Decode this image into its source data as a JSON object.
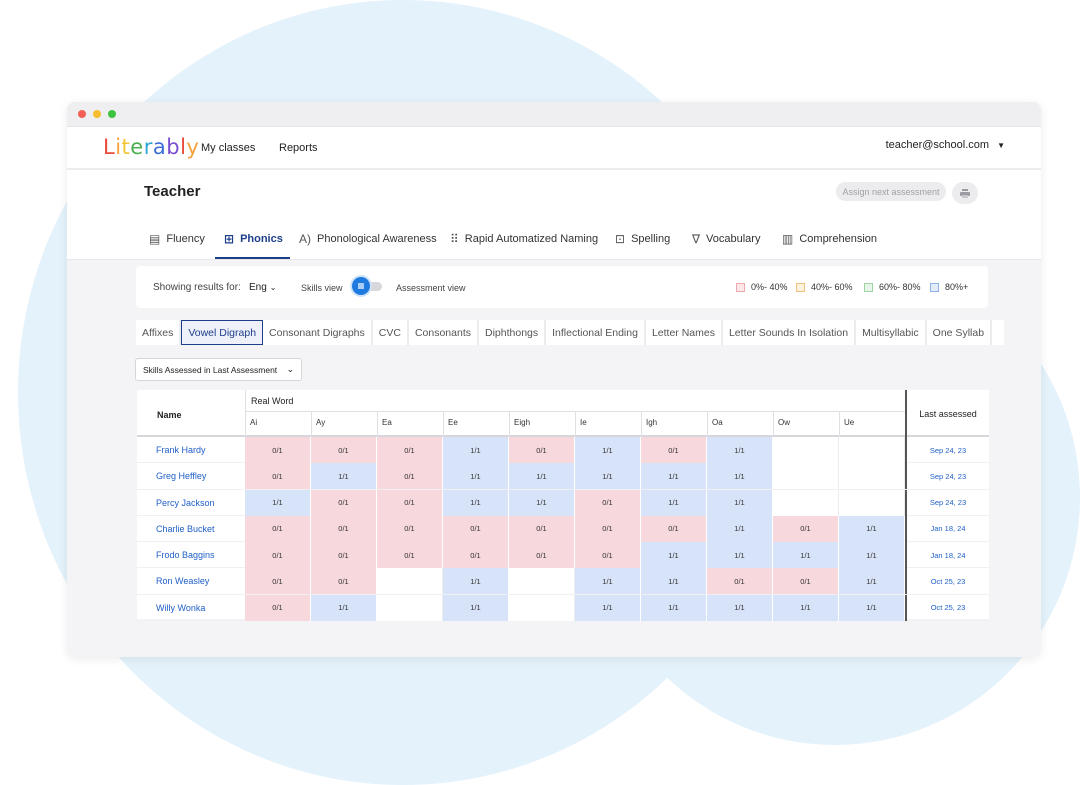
{
  "app": {
    "logo_letters": [
      {
        "ch": "L",
        "color": "#e84c3d"
      },
      {
        "ch": "i",
        "color": "#f3a33a"
      },
      {
        "ch": "t",
        "color": "#f3c531"
      },
      {
        "ch": "e",
        "color": "#4caf50"
      },
      {
        "ch": "r",
        "color": "#2fa7d9"
      },
      {
        "ch": "a",
        "color": "#3b6fd6"
      },
      {
        "ch": "b",
        "color": "#7b4fd1"
      },
      {
        "ch": "l",
        "color": "#e84c3d"
      },
      {
        "ch": "y",
        "color": "#f3a33a"
      }
    ],
    "nav": {
      "my_classes": "My classes",
      "reports": "Reports"
    },
    "user_email": "teacher@school.com"
  },
  "header": {
    "title": "Teacher",
    "assign_label": "Assign next assessment"
  },
  "tabs": [
    {
      "label": "Fluency",
      "icon": "fluency-icon",
      "active": false
    },
    {
      "label": "Phonics",
      "icon": "phonics-icon",
      "active": true
    },
    {
      "label": "Phonological Awareness",
      "icon": "phonological-icon",
      "active": false
    },
    {
      "label": "Rapid Automatized Naming",
      "icon": "ran-grid-icon",
      "active": false
    },
    {
      "label": "Spelling",
      "icon": "spelling-icon",
      "active": false
    },
    {
      "label": "Vocabulary",
      "icon": "vocabulary-icon",
      "active": false
    },
    {
      "label": "Comprehension",
      "icon": "book-icon",
      "active": false
    }
  ],
  "filters": {
    "showing_label": "Showing results for:",
    "language": "Eng",
    "skills_view": "Skills view",
    "assessment_view": "Assessment view",
    "legend": [
      {
        "label": "0%- 40%",
        "color": "#f0a7ae",
        "fill": "#fbe6e8"
      },
      {
        "label": "40%- 60%",
        "color": "#f3c07a",
        "fill": "#fdf1df"
      },
      {
        "label": "60%- 80%",
        "color": "#9fd3a3",
        "fill": "#e7f5e8"
      },
      {
        "label": "80%+",
        "color": "#8fb1ea",
        "fill": "#e3ecfb"
      }
    ]
  },
  "skill_tabs": [
    "Affixes",
    "Vowel Digraph",
    "Consonant Digraphs",
    "CVC",
    "Consonants",
    "Diphthongs",
    "Inflectional Ending",
    "Letter Names",
    "Letter Sounds In Isolation",
    "Multisyllabic",
    "One Syllab"
  ],
  "active_skill_tab": "Vowel Digraph",
  "dropdown": {
    "label": "Skills Assessed in Last Assessment"
  },
  "grid": {
    "name_header": "Name",
    "group_header": "Real Word",
    "last_header": "Last assessed",
    "columns": [
      "Ai",
      "Ay",
      "Ea",
      "Ee",
      "Eigh",
      "Ie",
      "Igh",
      "Oa",
      "Ow",
      "Ue"
    ],
    "rows": [
      {
        "name": "Frank Hardy",
        "date": "Sep 24, 23",
        "cells": [
          "0/1",
          "0/1",
          "0/1",
          "1/1",
          "0/1",
          "1/1",
          "0/1",
          "1/1",
          "",
          ""
        ]
      },
      {
        "name": "Greg Heffley",
        "date": "Sep 24, 23",
        "cells": [
          "0/1",
          "1/1",
          "0/1",
          "1/1",
          "1/1",
          "1/1",
          "1/1",
          "1/1",
          "",
          ""
        ]
      },
      {
        "name": "Percy Jackson",
        "date": "Sep 24, 23",
        "cells": [
          "1/1",
          "0/1",
          "0/1",
          "1/1",
          "1/1",
          "0/1",
          "1/1",
          "1/1",
          "",
          ""
        ]
      },
      {
        "name": "Charlie Bucket",
        "date": "Jan 18, 24",
        "cells": [
          "0/1",
          "0/1",
          "0/1",
          "0/1",
          "0/1",
          "0/1",
          "0/1",
          "1/1",
          "0/1",
          "1/1"
        ]
      },
      {
        "name": "Frodo Baggins",
        "date": "Jan 18, 24",
        "cells": [
          "0/1",
          "0/1",
          "0/1",
          "0/1",
          "0/1",
          "0/1",
          "1/1",
          "1/1",
          "1/1",
          "1/1"
        ]
      },
      {
        "name": "Ron Weasley",
        "date": "Oct 25, 23",
        "cells": [
          "0/1",
          "0/1",
          "",
          "1/1",
          "",
          "1/1",
          "1/1",
          "0/1",
          "0/1",
          "1/1"
        ]
      },
      {
        "name": "Willy Wonka",
        "date": "Oct 25, 23",
        "cells": [
          "0/1",
          "1/1",
          "",
          "1/1",
          "",
          "1/1",
          "1/1",
          "1/1",
          "1/1",
          "1/1"
        ]
      }
    ]
  }
}
